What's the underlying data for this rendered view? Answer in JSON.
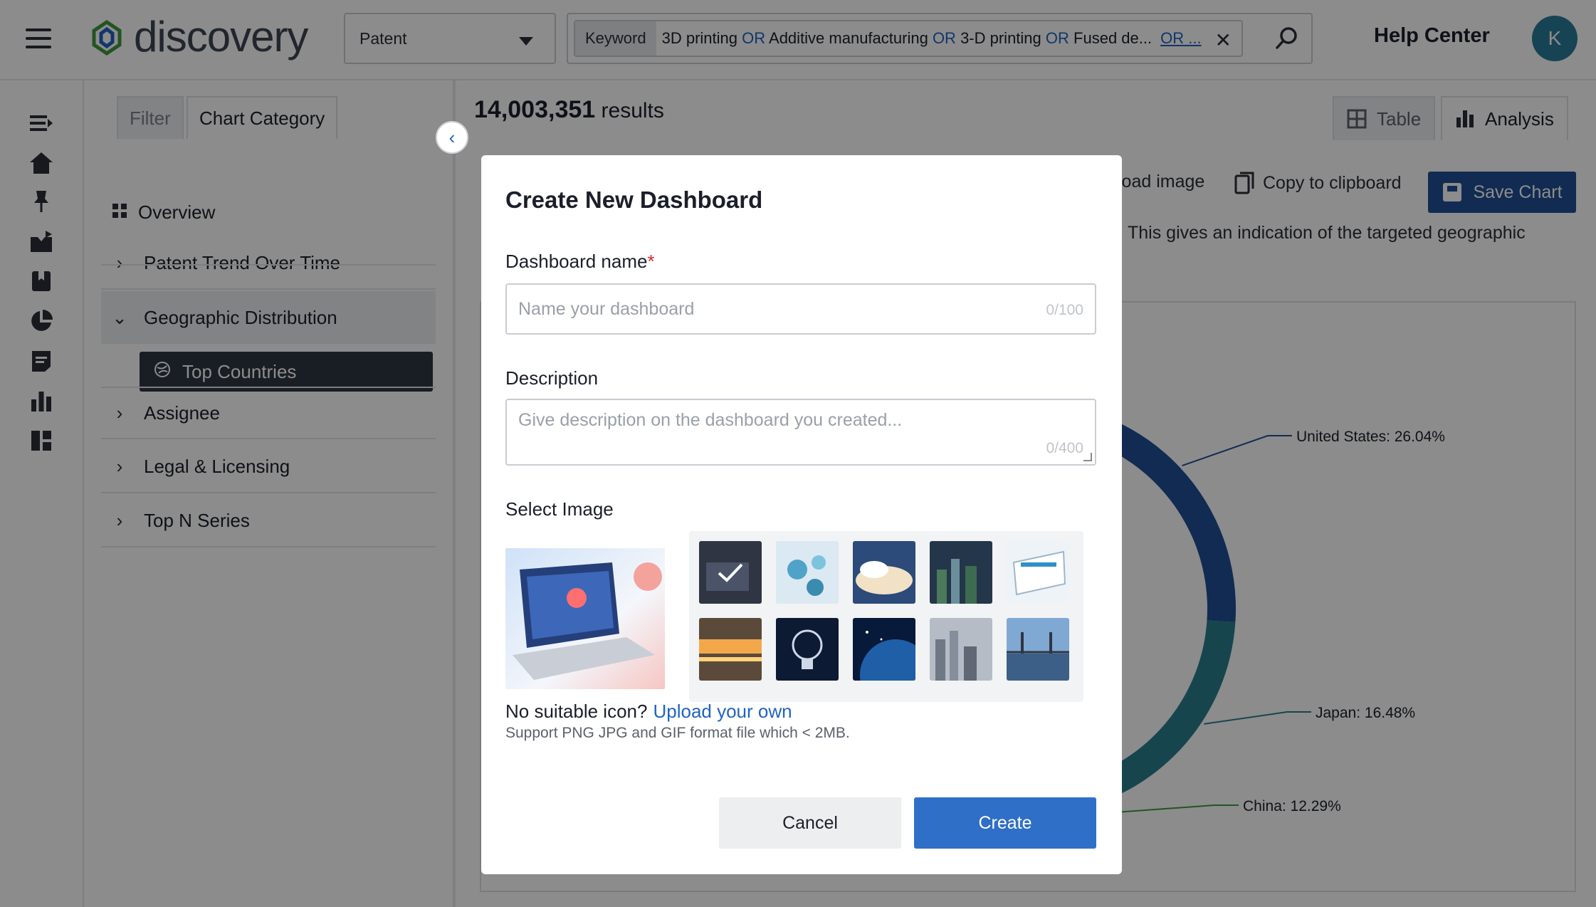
{
  "app": {
    "logo_text": "discovery"
  },
  "header": {
    "type_select": "Patent",
    "search": {
      "chip_label": "Keyword",
      "terms": [
        "3D printing",
        "Additive manufacturing",
        "3-D printing",
        "Fused de..."
      ],
      "operator": "OR",
      "more": "OR ..."
    },
    "help_center": "Help Center",
    "avatar_initial": "K"
  },
  "panel": {
    "tabs": {
      "filter": "Filter",
      "chart_category": "Chart Category"
    },
    "overview": "Overview",
    "items": [
      {
        "label": "Patent Trend Over Time"
      },
      {
        "label": "Geographic Distribution"
      },
      {
        "label": "Assignee"
      },
      {
        "label": "Legal & Licensing"
      },
      {
        "label": "Top N Series"
      }
    ],
    "sub_item": "Top Countries"
  },
  "main": {
    "results_count": "14,003,351",
    "results_label": "results",
    "view_tabs": {
      "table": "Table",
      "analysis": "Analysis"
    },
    "toolbar": {
      "download": "load image",
      "copy": "Copy to clipboard",
      "save": "Save Chart"
    },
    "description": "This gives an indication of the targeted geographic"
  },
  "chart_data": {
    "type": "pie",
    "slices": [
      {
        "label": "United States: 26.04%",
        "value": 26.04,
        "color": "#1f4f96"
      },
      {
        "label": "Japan: 16.48%",
        "value": 16.48,
        "color": "#2b7f8f"
      },
      {
        "label": "China: 12.29%",
        "value": 12.29,
        "color": "#3e9a3e"
      }
    ]
  },
  "modal": {
    "title": "Create New Dashboard",
    "name_label": "Dashboard name",
    "name_required": "*",
    "name_placeholder": "Name your dashboard",
    "name_counter": "0/100",
    "description_label": "Description",
    "description_placeholder": "Give description on the dashboard you created...",
    "description_counter": "0/400",
    "select_image_label": "Select Image",
    "no_icon_text": "No suitable icon?",
    "upload_link": "Upload your own",
    "support_text": "Support PNG JPG and GIF format file which < 2MB.",
    "cancel": "Cancel",
    "create": "Create"
  },
  "colors": {
    "primary": "#2f6fc8",
    "navy": "#1f4f96",
    "dark": "#2f3542"
  }
}
